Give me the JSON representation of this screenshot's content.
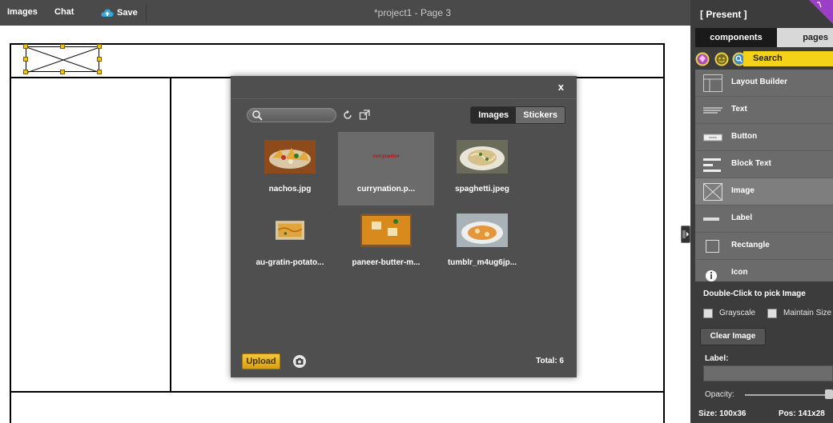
{
  "menu": {
    "images": "Images",
    "chat": "Chat",
    "save": "Save"
  },
  "title": "*project1 - Page 3",
  "dialog": {
    "close": "x",
    "tabs": [
      "Images",
      "Stickers"
    ],
    "active_tab": "Images",
    "images": [
      {
        "name": "nachos.jpg"
      },
      {
        "name": "currynation.p...",
        "logo_text": "currynation",
        "selected": true
      },
      {
        "name": "spaghetti.jpeg"
      },
      {
        "name": "au-gratin-potato..."
      },
      {
        "name": "paneer-butter-m..."
      },
      {
        "name": "tumblr_m4ug6jp..."
      }
    ],
    "upload": "Upload",
    "total": "Total: 6"
  },
  "panel": {
    "present": "[ Present ]",
    "tabs": {
      "components": "components",
      "pages": "pages"
    },
    "search": "Search",
    "components": [
      {
        "label": "Layout Builder",
        "icon": "layout-icon"
      },
      {
        "label": "Text",
        "icon": "text-icon"
      },
      {
        "label": "Button",
        "icon": "button-icon"
      },
      {
        "label": "Block Text",
        "icon": "block-text-icon"
      },
      {
        "label": "Image",
        "icon": "image-icon",
        "selected": true
      },
      {
        "label": "Label",
        "icon": "label-icon"
      },
      {
        "label": "Rectangle",
        "icon": "rectangle-icon"
      },
      {
        "label": "Icon",
        "icon": "info-icon"
      }
    ],
    "props_title": "Double-Click to pick Image",
    "grayscale": "Grayscale",
    "maintain_size": "Maintain Size",
    "clear_image": "Clear Image",
    "label_title": "Label:",
    "label_value": "",
    "opacity_label": "Opacity:",
    "opacity": 1.0,
    "status": {
      "size": "Size: 100x36",
      "pos": "Pos: 141x28"
    }
  },
  "colors": {
    "accent": "#f3d218",
    "dialog_bg": "#4f4f4f",
    "panel_bg": "#3c3c3c",
    "topbar_bg": "#4a4a4a"
  }
}
